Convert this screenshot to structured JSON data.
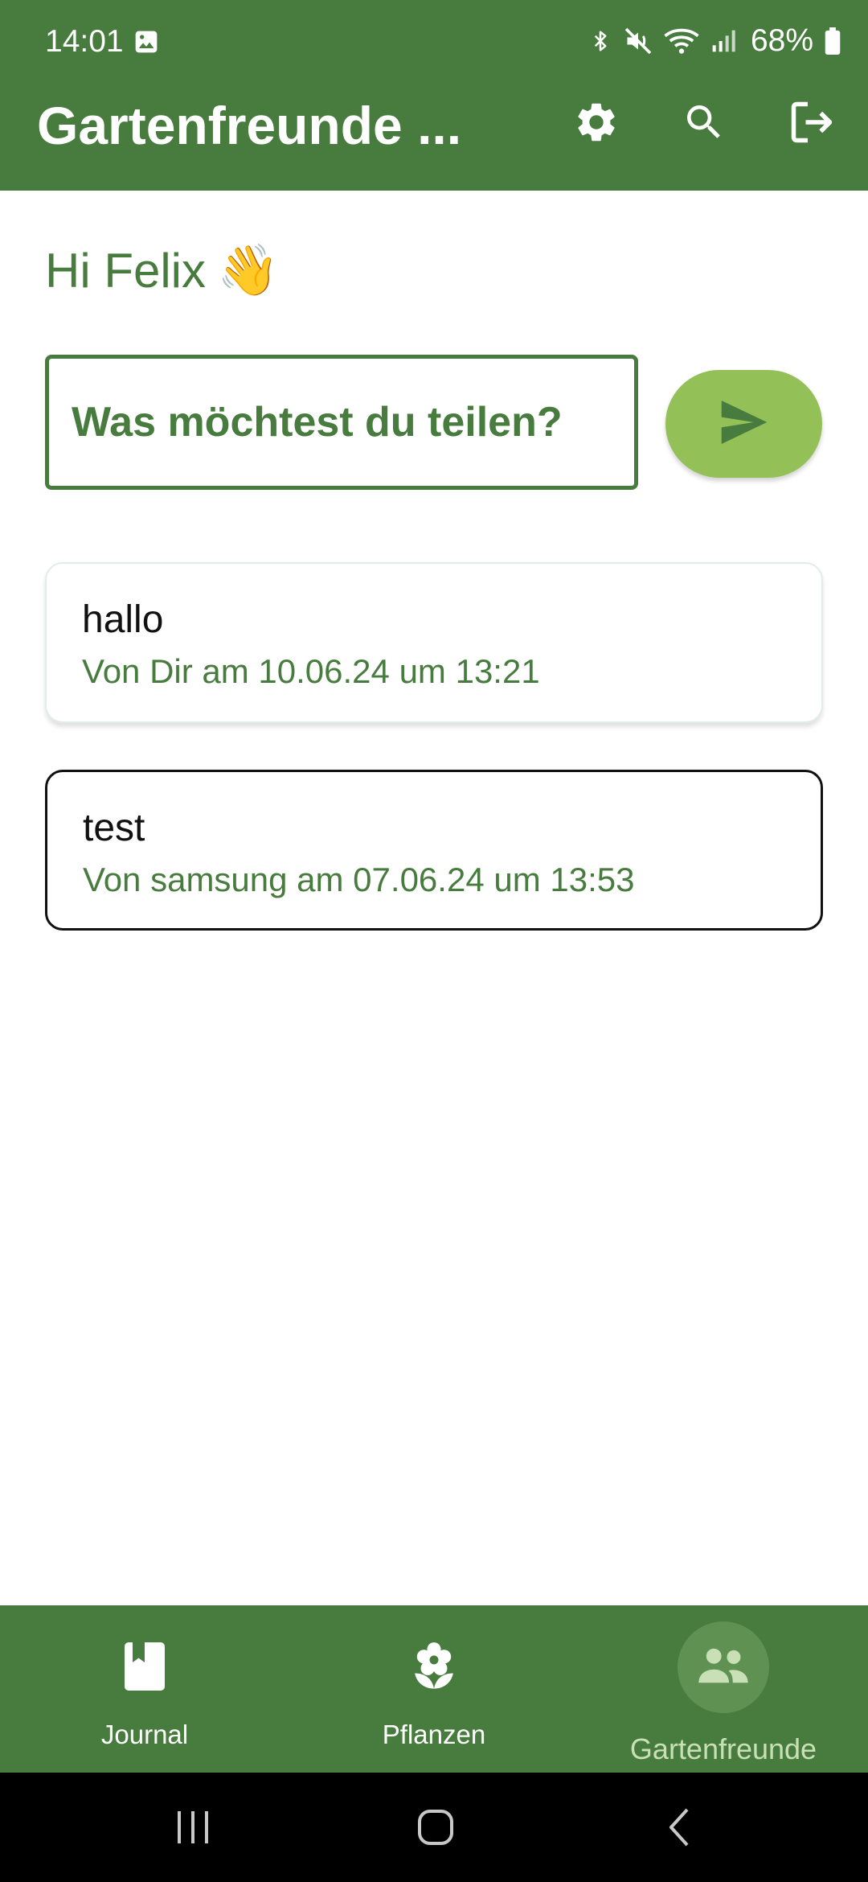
{
  "status_bar": {
    "time": "14:01",
    "battery": "68%"
  },
  "app_bar": {
    "title": "Gartenfreunde ..."
  },
  "greeting": {
    "text": "Hi Felix",
    "emoji": "👋"
  },
  "post_input": {
    "placeholder": "Was möchtest du teilen?",
    "value": ""
  },
  "posts": [
    {
      "text": "hallo",
      "meta": "Von Dir am 10.06.24 um 13:21"
    },
    {
      "text": "test",
      "meta": "Von samsung am 07.06.24 um 13:53"
    }
  ],
  "bottom_nav": {
    "items": [
      {
        "label": "Journal",
        "icon": "book-icon"
      },
      {
        "label": "Pflanzen",
        "icon": "flower-icon"
      },
      {
        "label": "Gartenfreunde",
        "icon": "people-icon",
        "selected": true
      }
    ]
  },
  "colors": {
    "primary": "#477c3e",
    "accent": "#93c158",
    "background": "#ffffff",
    "selected_pill": "#5f9153"
  }
}
